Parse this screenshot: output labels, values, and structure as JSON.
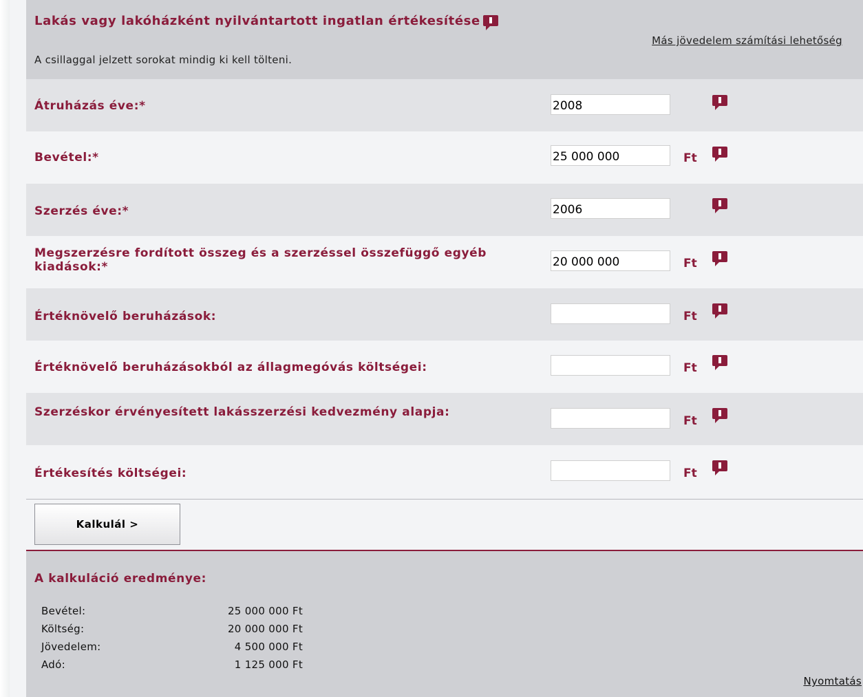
{
  "header": {
    "title": "Lakás vagy lakóházként nyilvántartott ingatlan értékesítése",
    "subtitle": "A csillaggal jelzett sorokat mindig ki kell tölteni.",
    "alt_link": "Más jövedelem számítási lehetőség",
    "icon": "info-icon"
  },
  "form": {
    "rows": [
      {
        "label": "Átruházás éve:*",
        "value": "2008",
        "unit": ""
      },
      {
        "label": "Bevétel:*",
        "value": "25 000 000",
        "unit": "Ft"
      },
      {
        "label": "Szerzés éve:*",
        "value": "2006",
        "unit": ""
      },
      {
        "label": "Megszerzésre fordított összeg és a szerzéssel összefüggő egyéb kiadások:*",
        "value": "20 000 000",
        "unit": "Ft"
      },
      {
        "label": "Értéknövelő beruházások:",
        "value": "",
        "unit": "Ft"
      },
      {
        "label": "Értéknövelő beruházásokból az állagmegóvás költségei:",
        "value": "",
        "unit": "Ft"
      },
      {
        "label": "Szerzéskor érvényesített lakásszerzési kedvezmény alapja:",
        "value": "",
        "unit": "Ft"
      },
      {
        "label": "Értékesítés költségei:",
        "value": "",
        "unit": "Ft"
      }
    ]
  },
  "button": {
    "label": "Kalkulál  >"
  },
  "results": {
    "title": "A kalkuláció eredménye:",
    "rows": [
      {
        "label": "Bevétel:",
        "value": "25 000 000 Ft"
      },
      {
        "label": "Költség:",
        "value": "20 000 000 Ft"
      },
      {
        "label": "Jövedelem:",
        "value": "4 500 000 Ft"
      },
      {
        "label": "Adó:",
        "value": "1 125 000 Ft"
      }
    ],
    "print_link": "Nyomtatás"
  },
  "colors": {
    "accent": "#8a1c3b",
    "header_bg": "#cfd0d4",
    "row_dark": "#e2e3e6",
    "row_light": "#f3f4f6"
  }
}
